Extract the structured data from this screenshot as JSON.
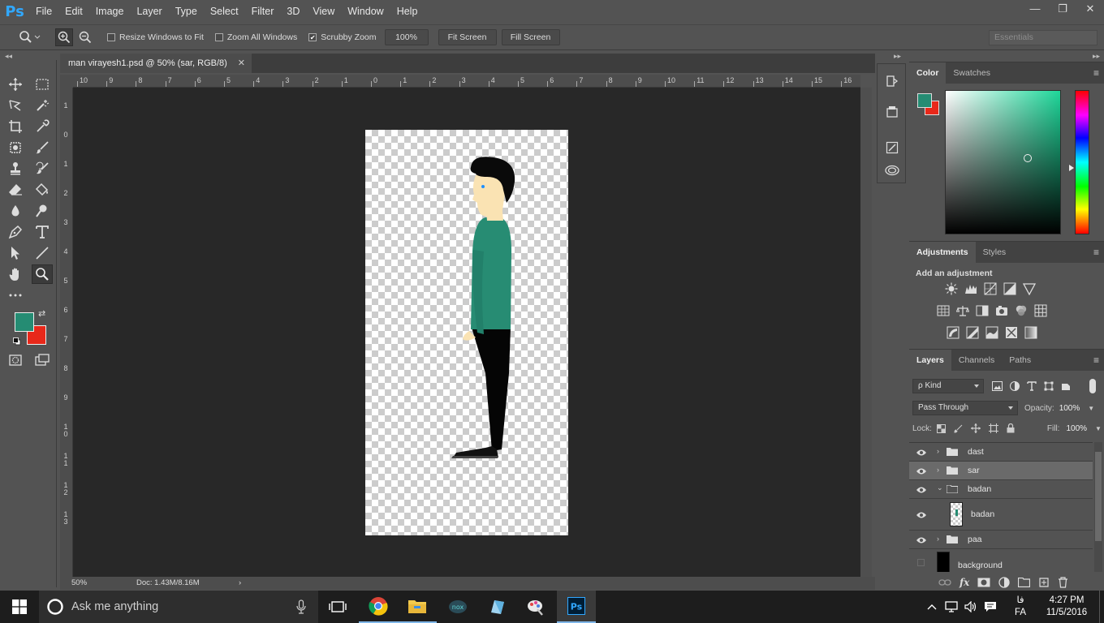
{
  "app": {
    "logo": "Ps",
    "accent": "#31a8ff"
  },
  "menu": [
    "File",
    "Edit",
    "Image",
    "Layer",
    "Type",
    "Select",
    "Filter",
    "3D",
    "View",
    "Window",
    "Help"
  ],
  "window_controls": {
    "minimize": "—",
    "restore": "❐",
    "close": "✕"
  },
  "options": {
    "resize_windows": "Resize Windows to Fit",
    "zoom_all": "Zoom All Windows",
    "scrubby_zoom": "Scrubby Zoom",
    "zoom_value": "100%",
    "fit_screen": "Fit Screen",
    "fill_screen": "Fill Screen",
    "workspace": "Essentials"
  },
  "collapse": {
    "left": "◂◂",
    "right": "▸▸"
  },
  "document": {
    "tab_title": "man virayesh1.psd @ 50% (sar, RGB/8)",
    "close": "✕",
    "zoom": "50%",
    "doc_info": "Doc: 1.43M/8.16M",
    "ruler_h": [
      "10",
      "9",
      "8",
      "7",
      "6",
      "5",
      "4",
      "3",
      "2",
      "1",
      "0",
      "1",
      "2",
      "3",
      "4",
      "5",
      "6",
      "7",
      "8",
      "9",
      "10",
      "11",
      "12",
      "13",
      "14",
      "15",
      "16"
    ],
    "ruler_v": [
      "1",
      "0",
      "1",
      "2",
      "3",
      "4",
      "5",
      "6",
      "7",
      "8",
      "9",
      "1 0",
      "1 1",
      "1 2",
      "1 3"
    ]
  },
  "colors": {
    "foreground": "#258c73",
    "background": "#e8281a"
  },
  "color_panel": {
    "tabs": [
      "Color",
      "Swatches"
    ],
    "active_tab": "Color",
    "menu": "≡"
  },
  "adjustments": {
    "tabs": [
      "Adjustments",
      "Styles"
    ],
    "active_tab": "Adjustments",
    "title": "Add an adjustment"
  },
  "layers_panel": {
    "tabs": [
      "Layers",
      "Channels",
      "Paths"
    ],
    "active_tab": "Layers",
    "kind": "ρ Kind",
    "blend_mode": "Pass Through",
    "opacity_label": "Opacity:",
    "opacity": "100%",
    "lock_label": "Lock:",
    "fill_label": "Fill:",
    "fill": "100%",
    "layers": [
      {
        "name": "dast",
        "type": "group",
        "expanded": false,
        "visible": true
      },
      {
        "name": "sar",
        "type": "group",
        "expanded": false,
        "visible": true,
        "selected": true
      },
      {
        "name": "badan",
        "type": "group",
        "expanded": true,
        "visible": true
      },
      {
        "name": "badan",
        "type": "layer",
        "visible": true
      },
      {
        "name": "paa",
        "type": "group",
        "expanded": false,
        "visible": true
      },
      {
        "name": "background",
        "type": "layer",
        "visible": false
      }
    ]
  },
  "taskbar": {
    "search_placeholder": "Ask me anything",
    "lang_indicator": "فا",
    "lang": "FA",
    "time": "4:27 PM",
    "date": "11/5/2016"
  }
}
